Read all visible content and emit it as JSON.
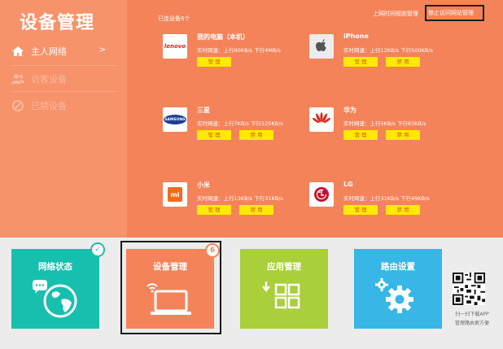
{
  "sidebar": {
    "title": "设备管理",
    "items": [
      {
        "label": "主人网络",
        "chevron": ">",
        "state": "active"
      },
      {
        "label": "访客设备",
        "state": "inactive"
      },
      {
        "label": "已禁设备",
        "state": "inactive"
      }
    ]
  },
  "header": {
    "device_count": "已连设备6个",
    "link_plain": "上网时间规则管理",
    "link_boxed": "禁止访问网站管理"
  },
  "devices": [
    {
      "name": "我的电脑（本机）",
      "speed": "实时网速：上行90KB/s 下行4MB/s",
      "logo": "lenovo",
      "logo_text": "lenovo",
      "manage": "管 理",
      "block": ""
    },
    {
      "name": "iPhone",
      "speed": "实时网速：上行12KB/s 下行500KB/s",
      "logo": "apple-logo",
      "manage": "管 理",
      "block": "禁 用"
    },
    {
      "name": "三星",
      "speed": "实时网速：上行7KB/s 下行125KB/s",
      "logo": "samsung",
      "logo_text": "SAMSUNG",
      "manage": "管 理",
      "block": "禁 用"
    },
    {
      "name": "华为",
      "speed": "实时网速：上行5KB/s 下行63KB/s",
      "logo": "huawei-logo",
      "manage": "管 理",
      "block": "禁 用"
    },
    {
      "name": "小米",
      "speed": "实时网速：上行13KB/s 下行31KB/s",
      "logo": "xiaomi",
      "logo_text": "mi",
      "manage": "管 理",
      "block": "禁 用"
    },
    {
      "name": "LG",
      "speed": "实时网速：上行31KB/s 下行49KB/s",
      "logo": "lg-logo",
      "manage": "管 理",
      "block": "禁 用"
    }
  ],
  "tiles": [
    {
      "label": "网络状态",
      "color": "#17bfae",
      "badge": "✓"
    },
    {
      "label": "设备管理",
      "color": "#f4835a",
      "badge": "6"
    },
    {
      "label": "应用管理",
      "color": "#a9cf3a"
    },
    {
      "label": "路由设置",
      "color": "#38b6e6"
    }
  ],
  "qr": {
    "line1": "扫一扫下载APP",
    "line2": "管理路由更方便"
  },
  "colors": {
    "main_bg": "#f4835a",
    "sidebar_bg": "#f7936b",
    "button": "#ffea00"
  }
}
